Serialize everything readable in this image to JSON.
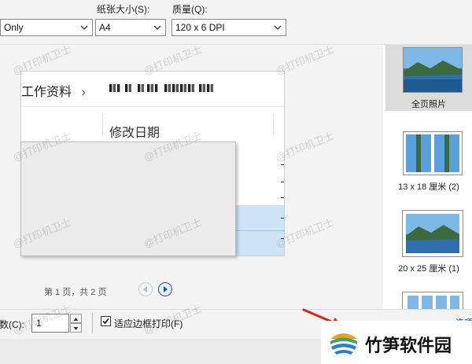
{
  "top_bar": {
    "pages_select_value": "Only",
    "paper_size_label": "纸张大小(S):",
    "paper_size_value": "A4",
    "quality_label": "质量(Q):",
    "quality_value": "120 x 6 DPI"
  },
  "preview": {
    "breadcrumb_title": "工作资料",
    "breadcrumb_sep": "›",
    "column_header": "修改日期",
    "pager_text": "第 1 页，共 2 页"
  },
  "layouts": [
    {
      "label": "全页照片",
      "selected": true
    },
    {
      "label": "13 x 18 厘米 (2)",
      "selected": false
    },
    {
      "label": "20 x 25 厘米 (1)",
      "selected": false
    }
  ],
  "bottom_bar": {
    "copies_label": "份数(C):",
    "copies_value": "1",
    "fit_frame_label": "适应边框打印(F)",
    "fit_frame_checked": true,
    "options_link": "选项"
  },
  "watermark_text": "@打印机卫士",
  "logo": {
    "text": "竹笋软件园"
  },
  "colors": {
    "accent": "#1f5fa8",
    "selection": "#cfe3f7",
    "arrow": "#e0201b"
  }
}
